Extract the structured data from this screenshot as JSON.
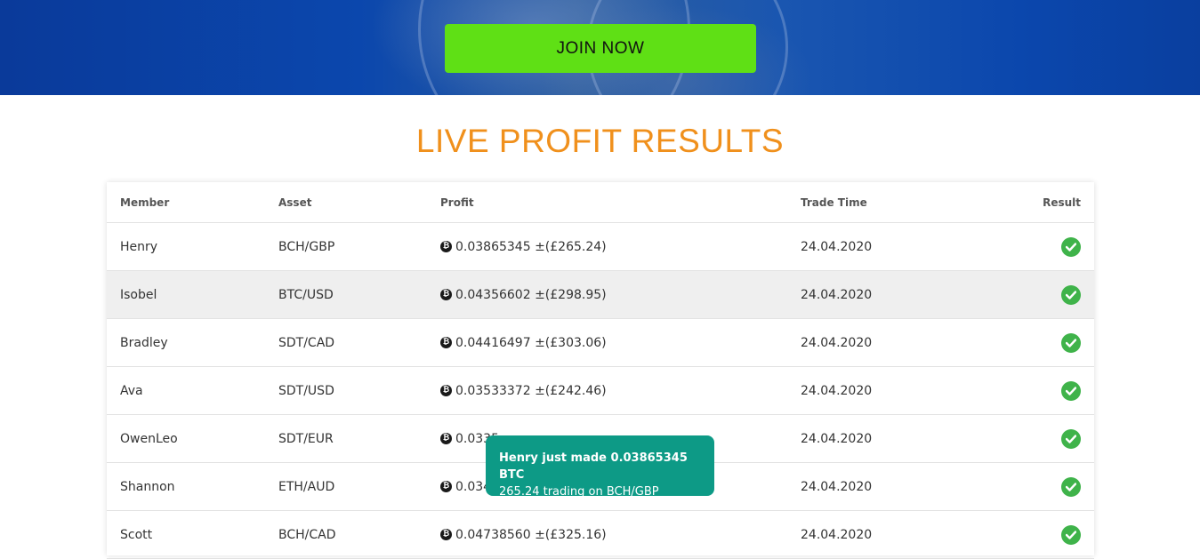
{
  "hero": {
    "join_button": "JOIN NOW"
  },
  "section": {
    "title": "LIVE PROFIT RESULTS"
  },
  "table": {
    "headers": {
      "member": "Member",
      "asset": "Asset",
      "profit": "Profit",
      "trade_time": "Trade Time",
      "result": "Result"
    },
    "rows": [
      {
        "member": "Henry",
        "asset": "BCH/GBP",
        "profit": "0.03865345 ±(£265.24)",
        "trade_time": "24.04.2020"
      },
      {
        "member": "Isobel",
        "asset": "BTC/USD",
        "profit": "0.04356602 ±(£298.95)",
        "trade_time": "24.04.2020"
      },
      {
        "member": "Bradley",
        "asset": "SDT/CAD",
        "profit": "0.04416497 ±(£303.06)",
        "trade_time": "24.04.2020"
      },
      {
        "member": "Ava",
        "asset": "SDT/USD",
        "profit": "0.03533372 ±(£242.46)",
        "trade_time": "24.04.2020"
      },
      {
        "member": "OwenLeo",
        "asset": "SDT/EUR",
        "profit": "0.0335",
        "trade_time": "24.04.2020"
      },
      {
        "member": "Shannon",
        "asset": "ETH/AUD",
        "profit": "0.034",
        "trade_time": "24.04.2020"
      },
      {
        "member": "Scott",
        "asset": "BCH/CAD",
        "profit": "0.04738560 ±(£325.16)",
        "trade_time": "24.04.2020"
      }
    ]
  },
  "toast": {
    "line1": "Henry just made 0.03865345 BTC",
    "line2": "265.24 trading on BCH/GBP"
  },
  "colors": {
    "accent_title": "#f0901c",
    "join_button": "#5fe015",
    "toast_bg": "#0d9a86",
    "result_check": "#3fb34a"
  },
  "icons": {
    "profit": "bitcoin-icon",
    "result": "check-circle-icon"
  }
}
